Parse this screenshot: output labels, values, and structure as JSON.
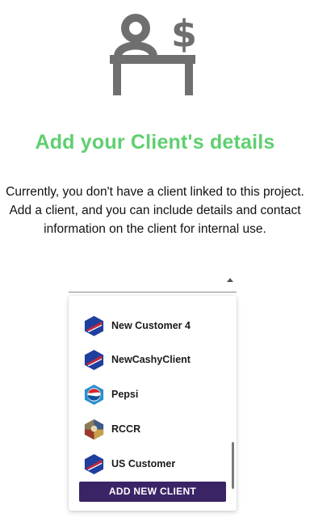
{
  "header": {
    "icon": "client-desk-dollar-icon",
    "title": "Add your Client's details",
    "title_color": "#5fcf6f"
  },
  "description": "Currently, you don't have a client linked to this project. Add a client, and you can include details and contact information on the client for internal use.",
  "client_select": {
    "value": "",
    "expanded": true
  },
  "dropdown": {
    "options": [
      {
        "label": "New Customer 4",
        "avatar": "blue-hexagon-logo-icon"
      },
      {
        "label": "NewCashyClient",
        "avatar": "blue-hexagon-logo-icon"
      },
      {
        "label": "Pepsi",
        "avatar": "pepsi-logo-icon"
      },
      {
        "label": "RCCR",
        "avatar": "photo-hexagon-logo-icon"
      },
      {
        "label": "US Customer",
        "avatar": "blue-hexagon-logo-icon"
      }
    ],
    "add_button_label": "ADD NEW CLIENT",
    "add_button_color": "#3a2466"
  }
}
